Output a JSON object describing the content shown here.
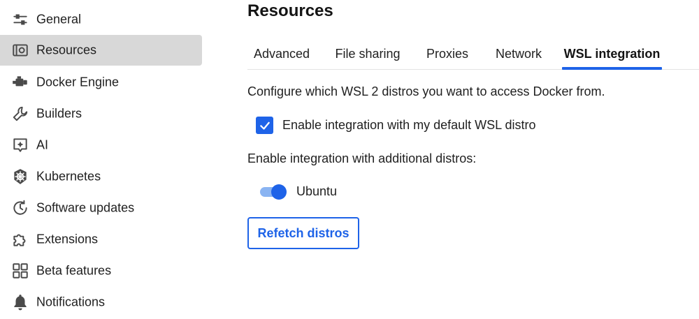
{
  "sidebar": {
    "items": [
      {
        "label": "General",
        "icon": "sliders-icon",
        "active": false
      },
      {
        "label": "Resources",
        "icon": "resources-icon",
        "active": true
      },
      {
        "label": "Docker Engine",
        "icon": "engine-icon",
        "active": false
      },
      {
        "label": "Builders",
        "icon": "wrench-icon",
        "active": false
      },
      {
        "label": "AI",
        "icon": "ai-icon",
        "active": false
      },
      {
        "label": "Kubernetes",
        "icon": "kubernetes-icon",
        "active": false
      },
      {
        "label": "Software updates",
        "icon": "update-icon",
        "active": false
      },
      {
        "label": "Extensions",
        "icon": "puzzle-icon",
        "active": false
      },
      {
        "label": "Beta features",
        "icon": "grid-icon",
        "active": false
      },
      {
        "label": "Notifications",
        "icon": "bell-icon",
        "active": false
      }
    ]
  },
  "main": {
    "title": "Resources",
    "tabs": [
      {
        "label": "Advanced",
        "active": false
      },
      {
        "label": "File sharing",
        "active": false
      },
      {
        "label": "Proxies",
        "active": false
      },
      {
        "label": "Network",
        "active": false
      },
      {
        "label": "WSL integration",
        "active": true
      }
    ],
    "description": "Configure which WSL 2 distros you want to access Docker from.",
    "default_distro": {
      "label": "Enable integration with my default WSL distro",
      "checked": true
    },
    "additional_heading": "Enable integration with additional distros:",
    "distros": [
      {
        "label": "Ubuntu",
        "enabled": true
      }
    ],
    "refetch_label": "Refetch distros"
  },
  "colors": {
    "accent": "#1e63e8",
    "toggle_track": "#8ab4f2",
    "active_bg": "#d8d8d8",
    "icon": "#4a4a4a"
  }
}
